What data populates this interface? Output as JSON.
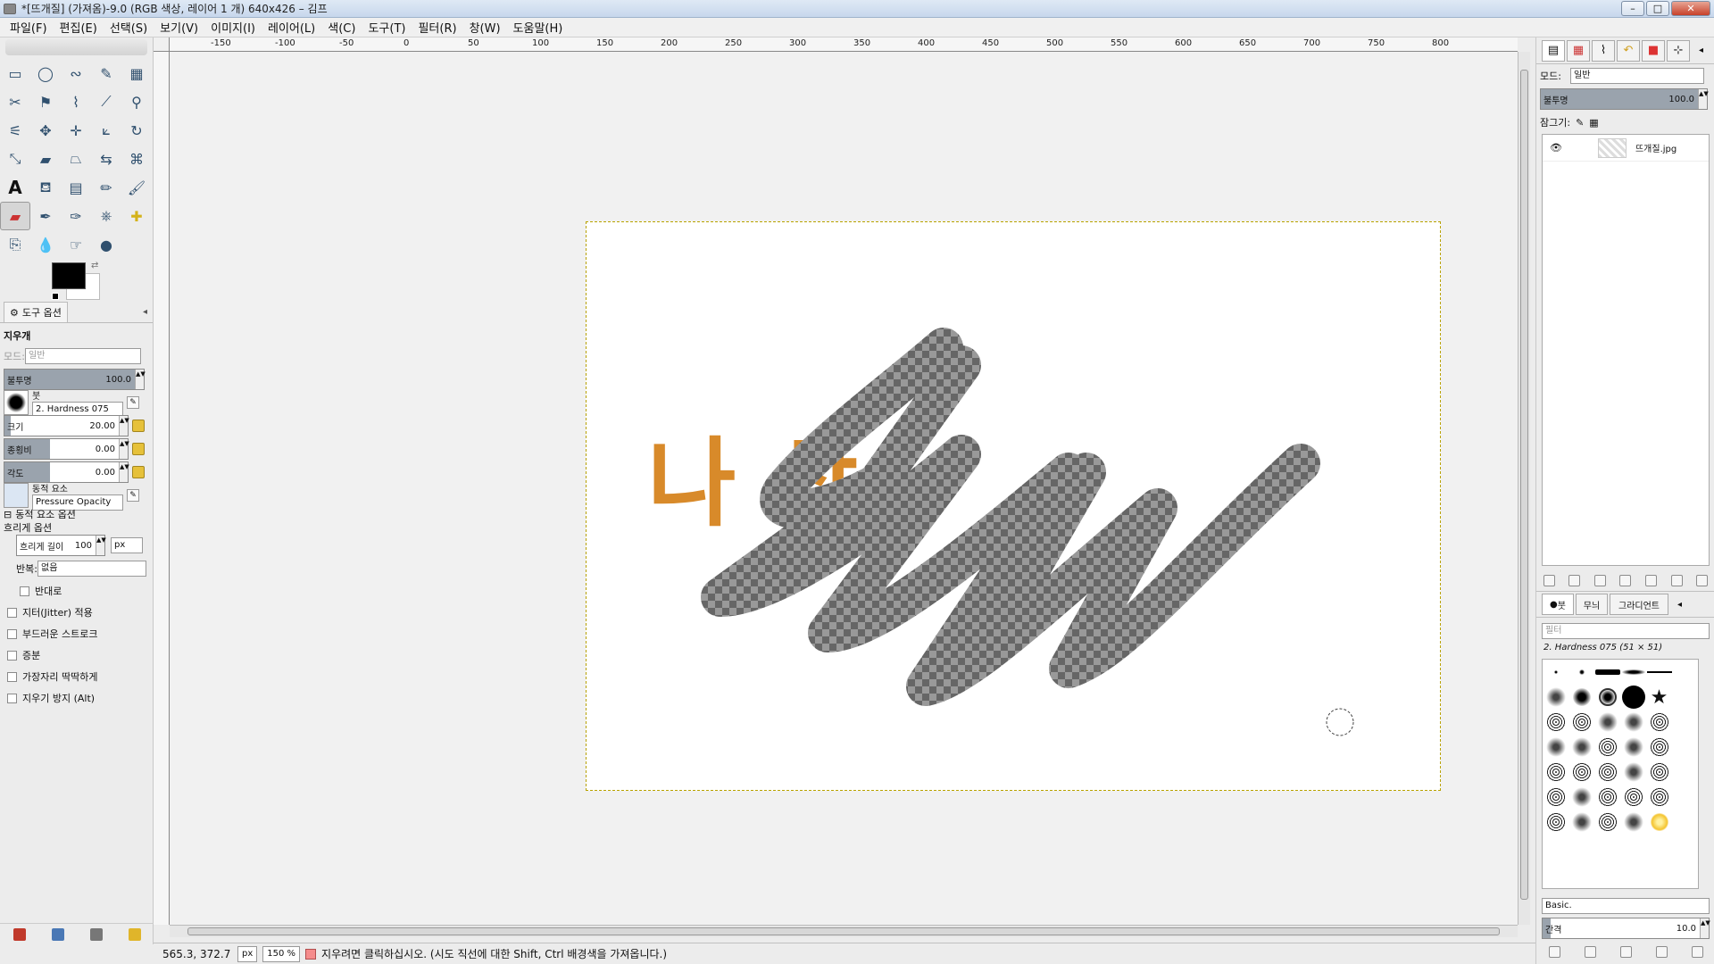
{
  "window": {
    "title": "*[뜨개질] (가져옴)-9.0 (RGB 색상, 레이어 1 개) 640x426 – 김프"
  },
  "menubar": [
    "파일(F)",
    "편집(E)",
    "선택(S)",
    "보기(V)",
    "이미지(I)",
    "레이어(L)",
    "색(C)",
    "도구(T)",
    "필터(R)",
    "창(W)",
    "도움말(H)"
  ],
  "tool_options": {
    "tab_label": "도구 옵션",
    "tool_name": "지우개",
    "mode_label": "모드:",
    "mode_value": "일반",
    "opacity_label": "불투명",
    "opacity_value": "100.0",
    "brush_label": "붓",
    "brush_value": "2. Hardness 075",
    "size_label": "크기",
    "size_value": "20.00",
    "aspect_label": "종횡비",
    "aspect_value": "0.00",
    "angle_label": "각도",
    "angle_value": "0.00",
    "dynamics_label": "동적 요소",
    "dynamics_value": "Pressure Opacity",
    "dynamics_options_label": "동적 요소 옵션",
    "fade_options_label": "흐리게 옵션",
    "fade_length_label": "흐리게 길이",
    "fade_length_value": "100",
    "fade_unit": "px",
    "repeat_label": "반복:",
    "repeat_value": "없음",
    "reverse_label": "반대로",
    "jitter_label": "지터(Jitter) 적용",
    "smooth_label": "부드러운 스트로크",
    "incremental_label": "증분",
    "hard_edge_label": "가장자리 딱딱하게",
    "anti_erase_label": "지우기 방지 (Alt)"
  },
  "ruler_top": [
    "-150",
    "-100",
    "-50",
    "0",
    "50",
    "100",
    "150",
    "200",
    "250",
    "300",
    "350",
    "400",
    "450",
    "500",
    "550",
    "600",
    "650",
    "700",
    "750",
    "800"
  ],
  "canvas": {
    "image_text": "나  상"
  },
  "statusbar": {
    "coords": "565.3, 372.7",
    "unit": "px",
    "zoom": "150 %",
    "message": "지우려면 클릭하십시오. (시도 직선에 대한 Shift, Ctrl 배경색을 가져옵니다.)"
  },
  "layers_panel": {
    "mode_label": "모드:",
    "mode_value": "일반",
    "opacity_label": "불투명",
    "opacity_value": "100.0",
    "lock_label": "잠그기:",
    "layer_name": "뜨개질.jpg"
  },
  "brushes_panel": {
    "tab_brush": "붓",
    "tab_pattern": "무늬",
    "tab_gradient": "그라디언트",
    "filter_placeholder": "필터",
    "selected_brush": "2. Hardness 075 (51 × 51)",
    "preset": "Basic.",
    "spacing_label": "간격",
    "spacing_value": "10.0"
  },
  "colors": {
    "accent_eraser": "#f58c8c",
    "image_text_orange": "#d88a2a",
    "image_text_magenta": "#9e3a5c"
  }
}
